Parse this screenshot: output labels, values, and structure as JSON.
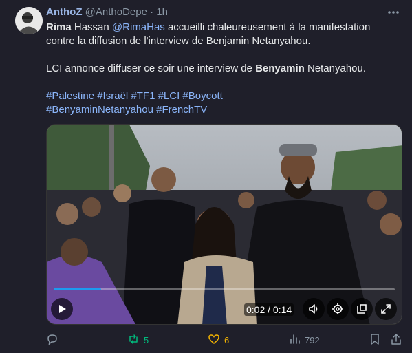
{
  "author": {
    "name": "AnthoZ",
    "handle": "@AnthoDepe",
    "separator": "·",
    "time": "1h"
  },
  "text": {
    "p1_bold": "Rima",
    "p1_a": " Hassan ",
    "p1_mention": "@RimaHas",
    "p1_b": " accueilli chaleureusement à la manifestation contre la diffusion de l'interview de Benjamin Netanyahou.",
    "p2_a": "LCI annonce diffuser ce soir une interview de ",
    "p2_bold": "Benyamin",
    "p2_b": " Netanyahou.",
    "hashtags_line1": "#Palestine #Israël #TF1 #LCI #Boycott",
    "hashtags_line2": "#BenyaminNetanyahou #FrenchTV"
  },
  "video": {
    "timecode": "0:02 / 0:14",
    "progress": 0.14
  },
  "actions": {
    "reply_count": "",
    "retweet_count": "5",
    "like_count": "6",
    "views_count": "792"
  },
  "colors": {
    "background": "#1f1f2a",
    "accent": "#1d9bf0",
    "link": "#8ab4f8",
    "retweet": "#00ba7c",
    "like": "#f4b400"
  },
  "icons": [
    "more-icon",
    "play-icon",
    "volume-icon",
    "settings-icon",
    "pip-icon",
    "fullscreen-icon",
    "reply-icon",
    "retweet-icon",
    "like-icon",
    "views-icon",
    "bookmark-icon",
    "share-icon"
  ]
}
